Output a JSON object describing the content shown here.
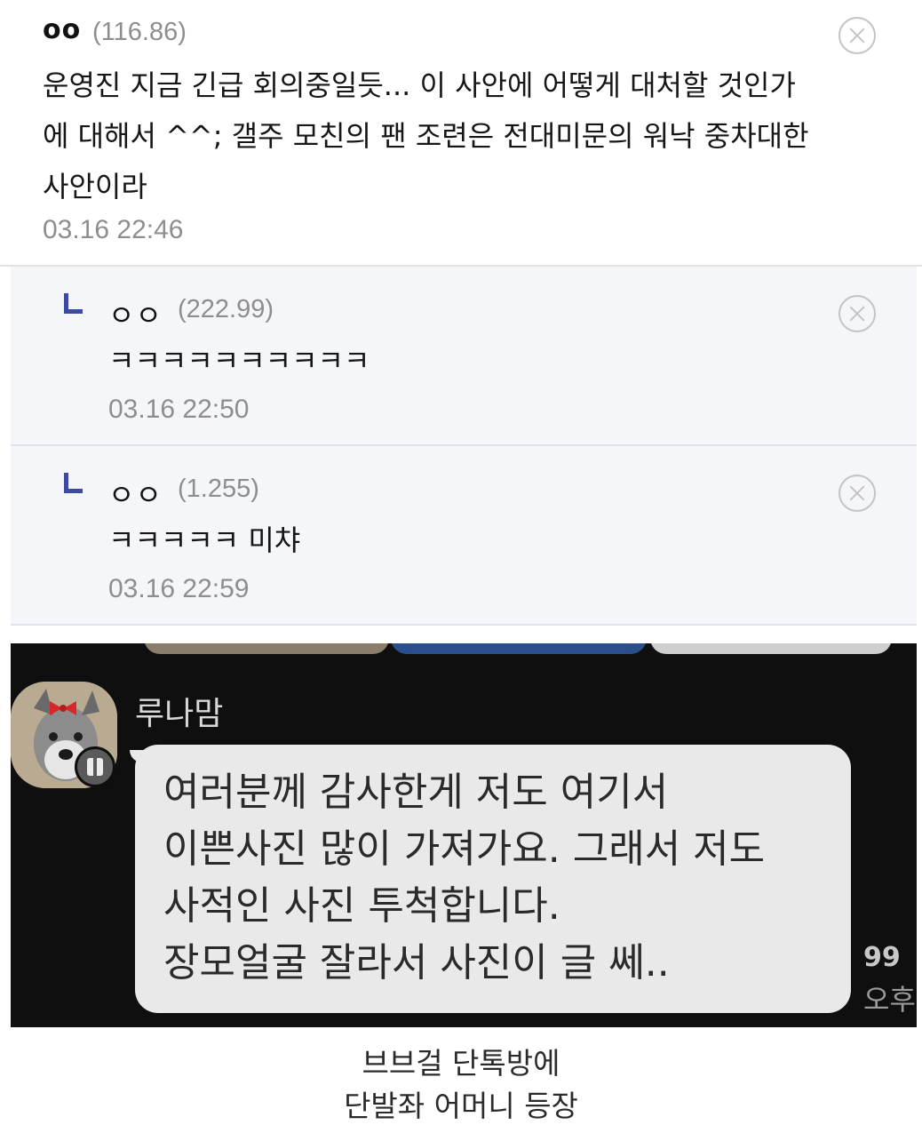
{
  "comments": [
    {
      "author": "oo",
      "score": "(116.86)",
      "lines": [
        "운영진 지금 긴급 회의중일듯... 이 사안에 어떻게 대처할 것인가",
        "에 대해서 ^^; 갤주 모친의 팬 조련은 전대미문의 워낙 중차대한",
        "사안이라"
      ],
      "time": "03.16 22:46"
    },
    {
      "author": "ㅇㅇ",
      "score": "(222.99)",
      "text": "ㅋㅋㅋㅋㅋㅋㅋㅋㅋㅋ",
      "time": "03.16 22:50"
    },
    {
      "author": "ㅇㅇ",
      "score": "(1.255)",
      "text": "ㅋㅋㅋㅋㅋ 미챠",
      "time": "03.16 22:59"
    }
  ],
  "chat": {
    "nickname": "루나맘",
    "message": "여러분께 감사한게 저도 여기서\n이쁜사진 많이 가져가요. 그래서 저도\n사적인 사진 투척합니다.\n장모얼굴 잘라서 사진이 글 쎄..",
    "unread": "99",
    "ampm": "오후"
  },
  "caption": [
    "브브걸 단톡방에",
    "단발좌 어머니 등장"
  ],
  "colors": {
    "reply_bg": "#f4f6fa",
    "reply_mark": "#3d4aa0",
    "chat_bg": "#0f0f0f",
    "bubble": "#e9e9e9"
  }
}
